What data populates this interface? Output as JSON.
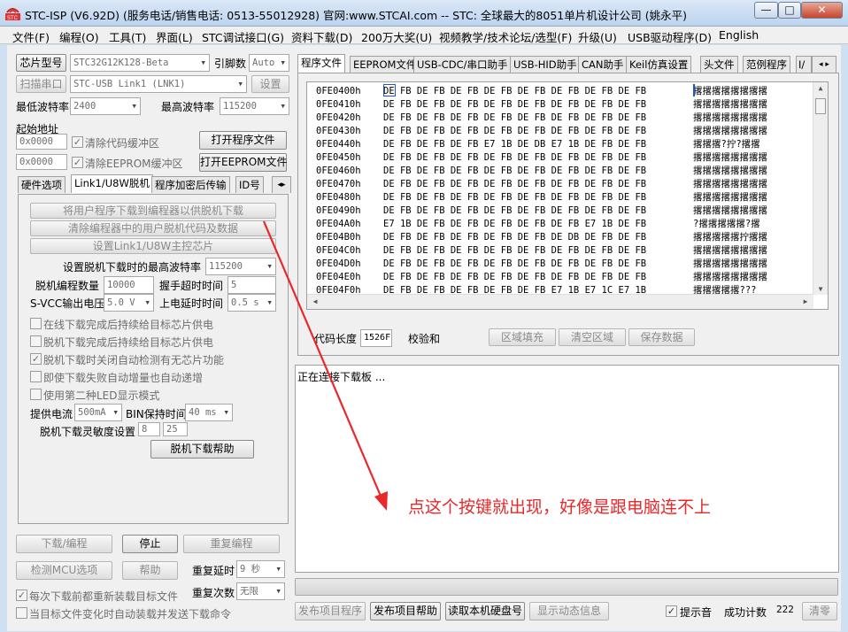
{
  "window": {
    "title": "STC-ISP (V6.92D) (服务电话/销售电话: 0513-55012928) 官网:www.STCAI.com  -- STC: 全球最大的8051单片机设计公司 (姚永平)",
    "min_label": "—",
    "max_label": "□",
    "close_label": "✕"
  },
  "menu": [
    "文件(F)",
    "编程(O)",
    "工具(T)",
    "界面(L)",
    "STC调试接口(G)",
    "资料下载(D)",
    "200万大奖(U)",
    "视频教学/技术论坛/选型(F)",
    "升级(U)",
    "USB驱动程序(D)",
    "English"
  ],
  "left": {
    "chip_btn": "芯片型号",
    "chip_value": "STC32G12K128-Beta",
    "pins_label": "引脚数",
    "pins_value": "Auto",
    "scan_btn": "扫描串口",
    "port_value": "STC-USB Link1 (LNK1)",
    "settings_btn": "设置",
    "min_baud_label": "最低波特率",
    "min_baud_value": "2400",
    "max_baud_label": "最高波特率",
    "max_baud_value": "115200",
    "start_addr_label": "起始地址",
    "addr1": "0x0000",
    "clear_code": "清除代码缓冲区",
    "open_prog": "打开程序文件",
    "addr2": "0x0000",
    "clear_eeprom": "清除EEPROM缓冲区",
    "open_eeprom": "打开EEPROM文件",
    "tabs": [
      "硬件选项",
      "Link1/U8W脱机",
      "程序加密后传输",
      "ID号"
    ],
    "offline": {
      "btn1": "将用户程序下载到编程器以供脱机下载",
      "btn2": "清除编程器中的用户脱机代码及数据",
      "btn3": "设置Link1/U8W主控芯片",
      "max_baud_label": "设置脱机下载时的最高波特率",
      "max_baud_value": "115200",
      "count_label": "脱机编程数量",
      "count_value": "10000",
      "handshake_label": "握手超时时间",
      "handshake_value": "5",
      "svcc_label": "S-VCC输出电压",
      "svcc_value": "5.0 V",
      "power_delay_label": "上电延时时间",
      "power_delay_value": "0.5 s",
      "opt1": "在线下载完成后持续给目标芯片供电",
      "opt2": "脱机下载完成后持续给目标芯片供电",
      "opt3": "脱机下载时关闭自动检测有无芯片功能",
      "opt4": "即使下载失败自动增量也自动递增",
      "opt5": "使用第二种LED显示模式",
      "current_label": "提供电流",
      "current_value": "500mA",
      "bin_label": "BIN保持时间",
      "bin_value": "40 ms",
      "sens_label": "脱机下载灵敏度设置",
      "sens1": "8",
      "sens2": "25",
      "help_btn": "脱机下载帮助"
    },
    "download_btn": "下载/编程",
    "stop_btn": "停止",
    "reprog_btn": "重复编程",
    "detect_btn": "检测MCU选项",
    "help_btn": "帮助",
    "repeat_delay_label": "重复延时",
    "repeat_delay_value": "9 秒",
    "repeat_count_label": "重复次数",
    "repeat_count_value": "无限",
    "reload_label": "每次下载前都重新装载目标文件",
    "auto_send_label": "当目标文件变化时自动装载并发送下载命令"
  },
  "right": {
    "tabs": [
      "程序文件",
      "EEPROM文件",
      "USB-CDC/串口助手",
      "USB-HID助手",
      "CAN助手",
      "Keil仿真设置",
      "头文件",
      "范例程序",
      "I/"
    ],
    "hex_rows": [
      {
        "addr": "0FE0400h",
        "bytes": "DE FB DE FB DE FB DE FB DE FB DE FB DE FB DE FB",
        "ascii": "撂撂撂撂撂撂撂撂"
      },
      {
        "addr": "0FE0410h",
        "bytes": "DE FB DE FB DE FB DE FB DE FB DE FB DE FB DE FB",
        "ascii": "撂撂撂撂撂撂撂撂"
      },
      {
        "addr": "0FE0420h",
        "bytes": "DE FB DE FB DE FB DE FB DE FB DE FB DE FB DE FB",
        "ascii": "撂撂撂撂撂撂撂撂"
      },
      {
        "addr": "0FE0430h",
        "bytes": "DE FB DE FB DE FB DE FB DE FB DE FB DE FB DE FB",
        "ascii": "撂撂撂撂撂撂撂撂"
      },
      {
        "addr": "0FE0440h",
        "bytes": "DE FB DE FB DE FB E7 1B DE DB E7 1B DE FB DE FB",
        "ascii": "撂撂撂?拧?撂撂"
      },
      {
        "addr": "0FE0450h",
        "bytes": "DE FB DE FB DE FB DE FB DE FB DE FB DE FB DE FB",
        "ascii": "撂撂撂撂撂撂撂撂"
      },
      {
        "addr": "0FE0460h",
        "bytes": "DE FB DE FB DE FB DE FB DE FB DE FB DE FB DE FB",
        "ascii": "撂撂撂撂撂撂撂撂"
      },
      {
        "addr": "0FE0470h",
        "bytes": "DE FB DE FB DE FB DE FB DE FB DE FB DE FB DE FB",
        "ascii": "撂撂撂撂撂撂撂撂"
      },
      {
        "addr": "0FE0480h",
        "bytes": "DE FB DE FB DE FB DE FB DE FB DE FB DE FB DE FB",
        "ascii": "撂撂撂撂撂撂撂撂"
      },
      {
        "addr": "0FE0490h",
        "bytes": "DE FB DE FB DE FB DE FB DE FB DE FB DE FB DE FB",
        "ascii": "撂撂撂撂撂撂撂撂"
      },
      {
        "addr": "0FE04A0h",
        "bytes": "E7 1B DE FB DE FB DE FB DE FB DE FB E7 1B DE FB",
        "ascii": "?撂撂撂撂撂?撂"
      },
      {
        "addr": "0FE04B0h",
        "bytes": "DE FB DE FB DE FB DE FB DE FB DE DB DE FB DE FB",
        "ascii": "撂撂撂撂撂拧撂撂"
      },
      {
        "addr": "0FE04C0h",
        "bytes": "DE FB DE FB DE FB DE FB DE FB DE FB DE FB DE FB",
        "ascii": "撂撂撂撂撂撂撂撂"
      },
      {
        "addr": "0FE04D0h",
        "bytes": "DE FB DE FB DE FB DE FB DE FB DE FB DE FB DE FB",
        "ascii": "撂撂撂撂撂撂撂撂"
      },
      {
        "addr": "0FE04E0h",
        "bytes": "DE FB DE FB DE FB DE FB DE FB DE FB DE FB DE FB",
        "ascii": "撂撂撂撂撂撂撂撂"
      },
      {
        "addr": "0FE04F0h",
        "bytes": "DE FB DE FB DE FB DE FB DE FB E7 1B E7 1C E7 1B",
        "ascii": "撂撂撂撂撂???"
      }
    ],
    "code_len_label": "代码长度",
    "code_len_value": "1526F",
    "checksum_label": "校验和",
    "fill_btn": "区域填充",
    "clear_btn": "清空区域",
    "save_btn": "保存数据",
    "status_message": "正在连接下载板 ...",
    "publish_btn": "发布项目程序",
    "publish_help_btn": "发布项目帮助",
    "read_disk_btn": "读取本机硬盘号",
    "show_dynamic_btn": "显示动态信息",
    "beep_label": "提示音",
    "success_label": "成功计数",
    "success_value": "222",
    "clear_count_btn": "清零"
  },
  "annotation": {
    "text": "点这个按键就出现，好像是跟电脑连不上",
    "color": "#e8282a"
  }
}
